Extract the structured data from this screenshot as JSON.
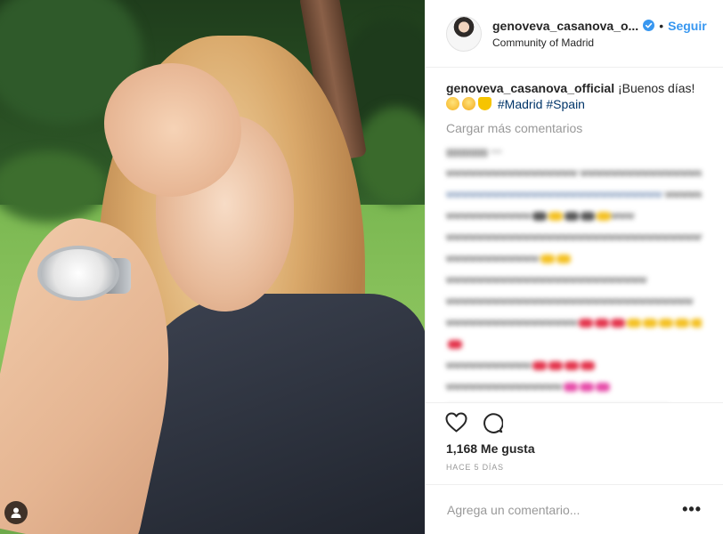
{
  "post": {
    "author": {
      "username": "genoveva_casanova_o...",
      "verified": true,
      "follow_label": "Seguir",
      "separator": "•",
      "location": "Community of Madrid"
    },
    "caption": {
      "username": "genoveva_casanova_official",
      "text": "¡Buenos días!",
      "emojis": [
        "smiling-emoji",
        "grinning-emoji",
        "yellow-heart-emoji"
      ],
      "hashtags": [
        "#Madrid",
        "#Spain"
      ]
    },
    "load_more_label": "Cargar más comentarios",
    "likes_label": "1,168 Me gusta",
    "timestamp": "HACE 5 DÍAS",
    "add_comment_placeholder": "Agrega un comentario...",
    "more_options": "•••",
    "icons": {
      "like": "heart-icon",
      "comment": "comment-icon",
      "tagged_user": "user-tag-icon",
      "verified": "verified-badge-icon"
    },
    "colors": {
      "link": "#3897f0",
      "hashtag": "#003569",
      "muted": "#999999",
      "text": "#262626"
    }
  }
}
